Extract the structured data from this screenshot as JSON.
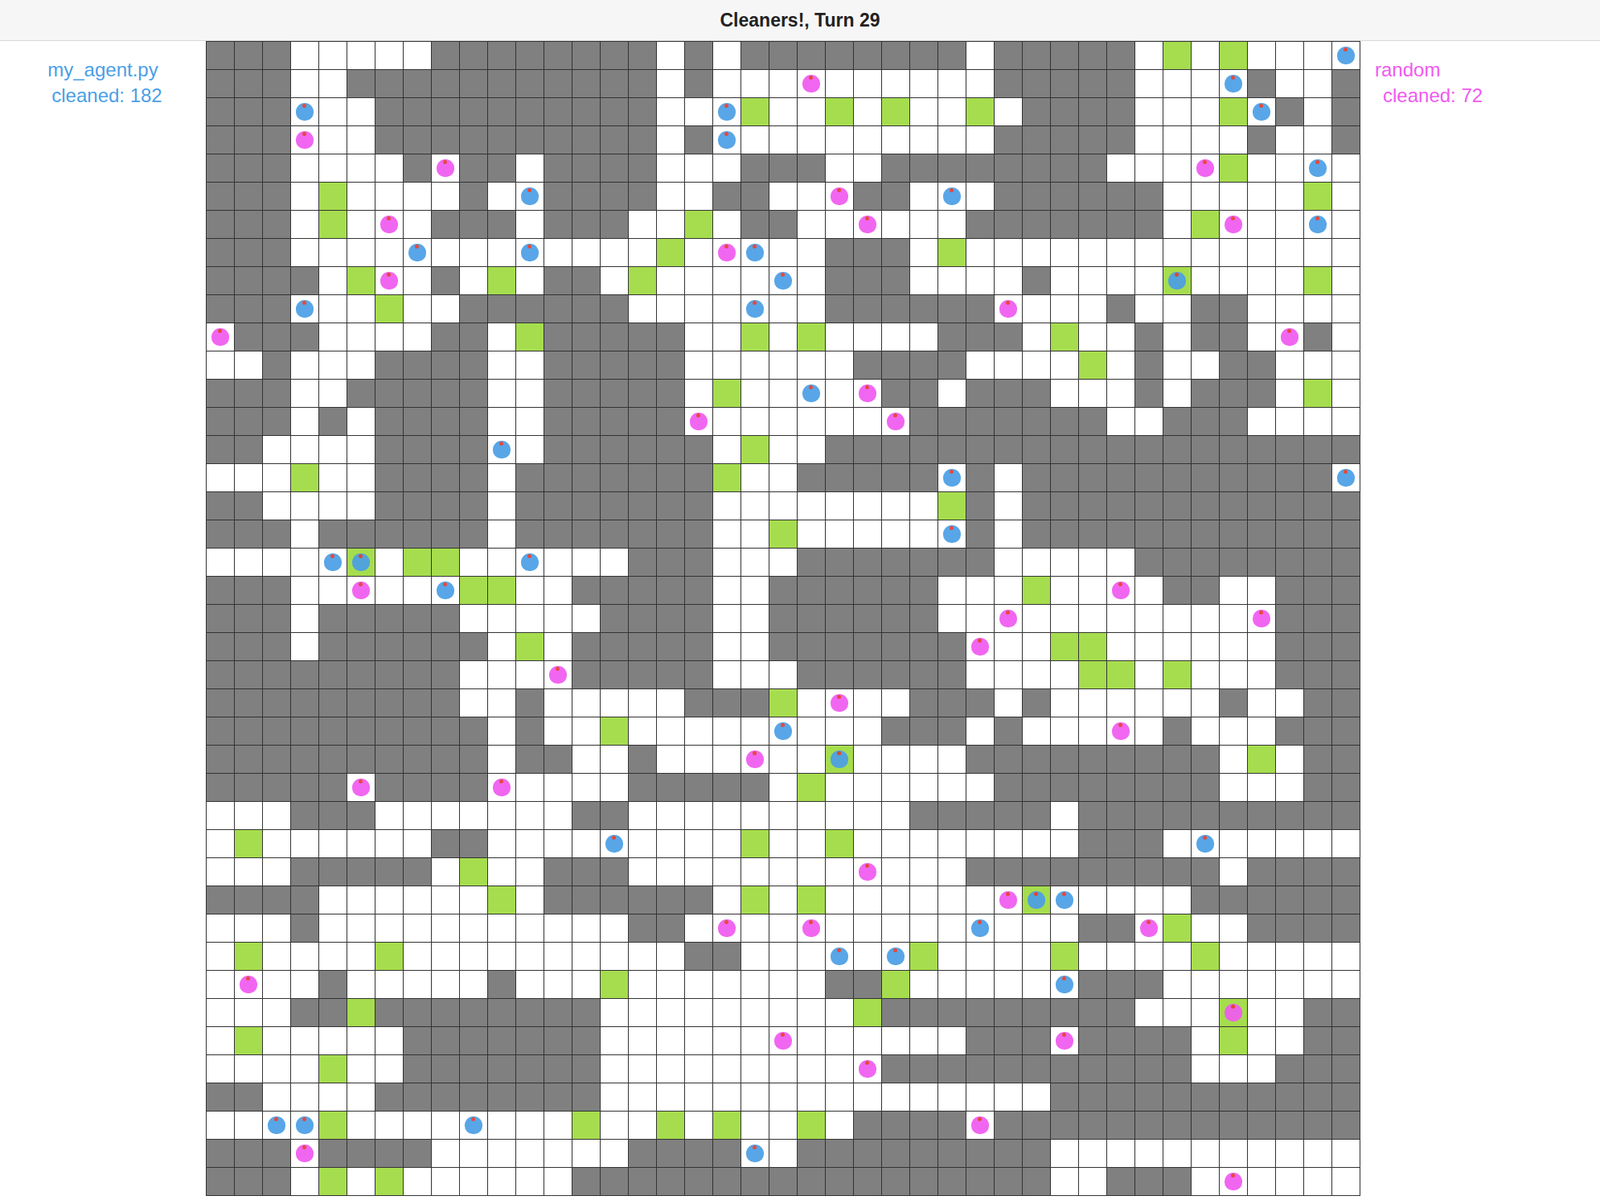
{
  "window": {
    "title": "Cleaners!, Turn 29"
  },
  "players": [
    {
      "name": "my_agent.py",
      "score": "cleaned: 182",
      "color": "#4a9fe6"
    },
    {
      "name": "random",
      "score": "cleaned: 72",
      "color": "#f05af0"
    }
  ],
  "board": {
    "legend": {
      "#": "wall",
      ".": "floor",
      "g": "dirty"
    },
    "rows": [
      "###.....########.#.########.#####.g.g....",
      "###..###########.#..........#####....#..#",
      "###...##########...g..g.g..g.####...g.#.#",
      "###...##########.#..........#####....#..#",
      "###....#.##.####...###..########....g....",
      "###.g....#..####..##...##...######.....g.",
      "###.g...###.###..g.##......#######.g.....",
      "###.............g.....###.g..............",
      "####.g..#.g.##.g......###....#....g....g.",
      "###...g..######.......######....#..##....",
      ".###....##.g#####..g.g....###.g..#.##..#.",
      "..#...####..#####......####....g.#..##...",
      "###..#####..#####.g.....##.###...#.###.g.",
      "###.#.####..#####........#######..###....",
      "##....####..######.g..###################",
      "...g..####.#######g..#####.#.###########.",
      "##....####.#######........g#.############",
      "###.######.#######..g......#.############",
      ".....g.gg......###...#######.....########",
      "###......gg..#####..######...g....##..###",
      "###.#####.....####..######............###",
      "###.######.g.#####..#######...gg......###",
      "#########....#####...######....gg.g...###",
      "#########..#.....###g....###.#......#..##",
      "##########.#..g.........###.#.....#...###",
      "##########.##..#......g....#########.g.##",
      "#####.####.....#####.g......########...##",
      "...###.......##..........#####.##########",
      ".g......##.........g..g........###.......",
      "...#####.g..###............#########.####",
      "####......g.######.g.g.......g.....######",
      "...#...........##..............##.g..####",
      ".g....g..........##......g....g....g.....",
      "....#.....#...g.......##g......###.......",
      "...##g########.........g#########...g..##",
      ".g.....#######.............###.####.g..##",
      "....g..#######..........###########...###",
      "##....########................###########",
      "....g........g..g.g..g.####.#############",
      "###.####.......####..#########...........",
      "###.g.g......#################..###......"
    ]
  },
  "agents": [
    {
      "player": 0,
      "row": 0,
      "col": 40
    },
    {
      "player": 0,
      "row": 1,
      "col": 36
    },
    {
      "player": 0,
      "row": 2,
      "col": 3
    },
    {
      "player": 0,
      "row": 2,
      "col": 18
    },
    {
      "player": 0,
      "row": 2,
      "col": 37
    },
    {
      "player": 0,
      "row": 3,
      "col": 18
    },
    {
      "player": 0,
      "row": 4,
      "col": 39
    },
    {
      "player": 0,
      "row": 5,
      "col": 11
    },
    {
      "player": 0,
      "row": 5,
      "col": 26
    },
    {
      "player": 0,
      "row": 6,
      "col": 39
    },
    {
      "player": 0,
      "row": 7,
      "col": 7
    },
    {
      "player": 0,
      "row": 7,
      "col": 11
    },
    {
      "player": 0,
      "row": 7,
      "col": 19
    },
    {
      "player": 0,
      "row": 8,
      "col": 20
    },
    {
      "player": 0,
      "row": 8,
      "col": 34
    },
    {
      "player": 0,
      "row": 9,
      "col": 3
    },
    {
      "player": 0,
      "row": 9,
      "col": 19
    },
    {
      "player": 0,
      "row": 12,
      "col": 21
    },
    {
      "player": 0,
      "row": 14,
      "col": 10
    },
    {
      "player": 0,
      "row": 15,
      "col": 26
    },
    {
      "player": 0,
      "row": 15,
      "col": 40
    },
    {
      "player": 0,
      "row": 17,
      "col": 26
    },
    {
      "player": 0,
      "row": 18,
      "col": 4
    },
    {
      "player": 0,
      "row": 18,
      "col": 5
    },
    {
      "player": 0,
      "row": 18,
      "col": 11
    },
    {
      "player": 0,
      "row": 19,
      "col": 8
    },
    {
      "player": 0,
      "row": 24,
      "col": 20
    },
    {
      "player": 0,
      "row": 25,
      "col": 22
    },
    {
      "player": 0,
      "row": 28,
      "col": 14
    },
    {
      "player": 0,
      "row": 28,
      "col": 35
    },
    {
      "player": 0,
      "row": 30,
      "col": 29
    },
    {
      "player": 0,
      "row": 30,
      "col": 30
    },
    {
      "player": 0,
      "row": 31,
      "col": 27
    },
    {
      "player": 0,
      "row": 32,
      "col": 22
    },
    {
      "player": 0,
      "row": 32,
      "col": 24
    },
    {
      "player": 0,
      "row": 33,
      "col": 30
    },
    {
      "player": 0,
      "row": 38,
      "col": 2
    },
    {
      "player": 0,
      "row": 38,
      "col": 3
    },
    {
      "player": 0,
      "row": 38,
      "col": 9
    },
    {
      "player": 0,
      "row": 39,
      "col": 19
    },
    {
      "player": 1,
      "row": 1,
      "col": 21
    },
    {
      "player": 1,
      "row": 3,
      "col": 3
    },
    {
      "player": 1,
      "row": 4,
      "col": 8
    },
    {
      "player": 1,
      "row": 4,
      "col": 35
    },
    {
      "player": 1,
      "row": 5,
      "col": 22
    },
    {
      "player": 1,
      "row": 6,
      "col": 6
    },
    {
      "player": 1,
      "row": 6,
      "col": 23
    },
    {
      "player": 1,
      "row": 6,
      "col": 36
    },
    {
      "player": 1,
      "row": 7,
      "col": 18
    },
    {
      "player": 1,
      "row": 8,
      "col": 6
    },
    {
      "player": 1,
      "row": 9,
      "col": 28
    },
    {
      "player": 1,
      "row": 10,
      "col": 0
    },
    {
      "player": 1,
      "row": 10,
      "col": 38
    },
    {
      "player": 1,
      "row": 12,
      "col": 23
    },
    {
      "player": 1,
      "row": 13,
      "col": 17
    },
    {
      "player": 1,
      "row": 13,
      "col": 24
    },
    {
      "player": 1,
      "row": 19,
      "col": 5
    },
    {
      "player": 1,
      "row": 19,
      "col": 32
    },
    {
      "player": 1,
      "row": 20,
      "col": 28
    },
    {
      "player": 1,
      "row": 20,
      "col": 37
    },
    {
      "player": 1,
      "row": 21,
      "col": 27
    },
    {
      "player": 1,
      "row": 22,
      "col": 12
    },
    {
      "player": 1,
      "row": 23,
      "col": 22
    },
    {
      "player": 1,
      "row": 24,
      "col": 32
    },
    {
      "player": 1,
      "row": 25,
      "col": 19
    },
    {
      "player": 1,
      "row": 26,
      "col": 5
    },
    {
      "player": 1,
      "row": 26,
      "col": 10
    },
    {
      "player": 1,
      "row": 29,
      "col": 23
    },
    {
      "player": 1,
      "row": 30,
      "col": 28
    },
    {
      "player": 1,
      "row": 31,
      "col": 18
    },
    {
      "player": 1,
      "row": 31,
      "col": 21
    },
    {
      "player": 1,
      "row": 31,
      "col": 33
    },
    {
      "player": 1,
      "row": 33,
      "col": 1
    },
    {
      "player": 1,
      "row": 34,
      "col": 36
    },
    {
      "player": 1,
      "row": 35,
      "col": 20
    },
    {
      "player": 1,
      "row": 35,
      "col": 30
    },
    {
      "player": 1,
      "row": 36,
      "col": 23
    },
    {
      "player": 1,
      "row": 38,
      "col": 27
    },
    {
      "player": 1,
      "row": 39,
      "col": 3
    },
    {
      "player": 1,
      "row": 40,
      "col": 36
    }
  ]
}
